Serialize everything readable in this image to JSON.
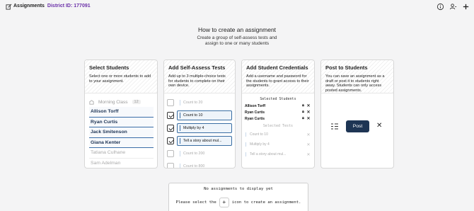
{
  "app": {
    "title": "Assignments",
    "district": "District ID: 177091"
  },
  "intro": {
    "heading": "How to create an assignment",
    "subheading_line1": "Create a group of self-assess tests and",
    "subheading_line2": "assign to one or many students"
  },
  "cards": {
    "students": {
      "title": "Select Students",
      "desc": "Select one or more students to add to your assignment.",
      "class_name": "Morning Class",
      "class_count": "12",
      "items": [
        {
          "name": "Allison Torff",
          "selected": true
        },
        {
          "name": "Ryan Curtis",
          "selected": true
        },
        {
          "name": "Jack Smitenson",
          "selected": true
        },
        {
          "name": "Giana Kenter",
          "selected": true
        },
        {
          "name": "Tatiana Culhane",
          "selected": false
        },
        {
          "name": "Sam Adelman",
          "selected": false
        }
      ]
    },
    "tests": {
      "title": "Add Self-Assess Tests",
      "desc": "Add up to 3 multiple-choice tests for students to complete on their own device.",
      "items": [
        {
          "name": "Count to 20",
          "checked": false
        },
        {
          "name": "Count to 10",
          "checked": true
        },
        {
          "name": "Multiply by 4",
          "checked": true
        },
        {
          "name": "Tell a story about mul...",
          "checked": true
        },
        {
          "name": "Count to 200",
          "checked": false
        },
        {
          "name": "Count to 800",
          "checked": false
        }
      ]
    },
    "credentials": {
      "title": "Add Student Credentials",
      "desc": "Add a username and password for the students to grant access to their assignments.",
      "selected_students_label": "Selected Students",
      "students": [
        "Allison Torff",
        "Ryan Curtis",
        "Ryan Curtis"
      ],
      "selected_tests_label": "Selected Tests",
      "tests": [
        "Count to 10",
        "Multiply by 4",
        "Tell a story about mul..."
      ]
    },
    "post": {
      "title": "Post to Students",
      "desc": "You can save an assignment as a draft or post it to students right away. Students can only access posted assignments.",
      "post_label": "Post"
    }
  },
  "empty_state": {
    "line1": "No assignments to display yet",
    "line2_before": "Please select the",
    "plus": "+",
    "line2_after": "icon to create an assignment."
  },
  "icons": {
    "logo": "edit-note-icon",
    "info": "info-icon",
    "users": "users-icon",
    "add": "plus-icon",
    "lock": "lock-icon",
    "close": "close-icon",
    "list": "checklist-icon"
  }
}
